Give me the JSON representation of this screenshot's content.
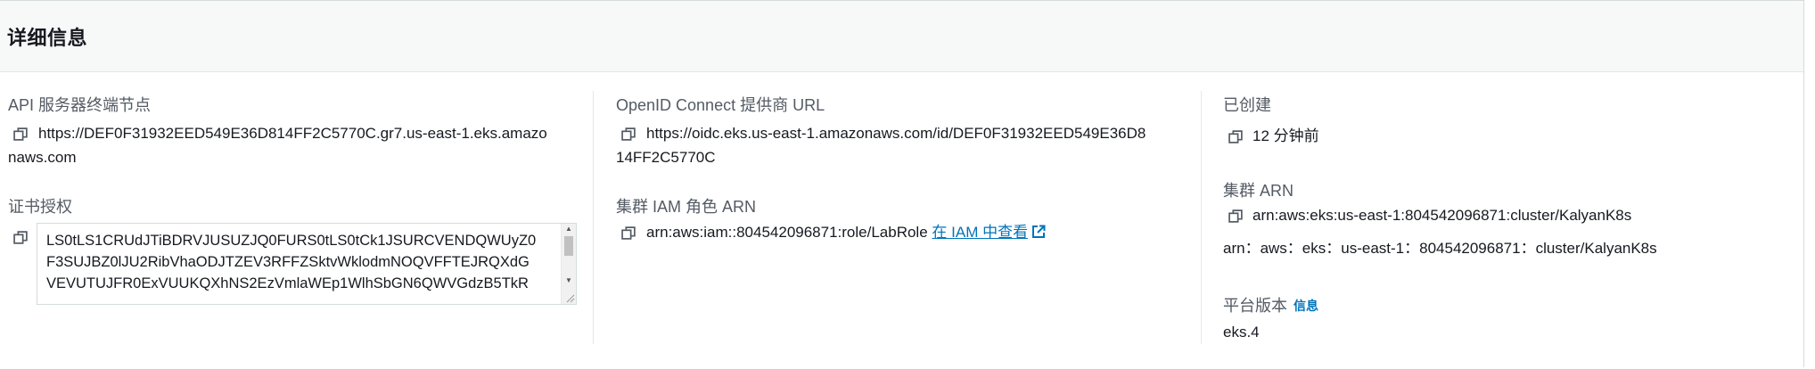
{
  "panel": {
    "title": "详细信息"
  },
  "api_endpoint": {
    "label": "API 服务器终端节点",
    "value_line1": "https://DEF0F31932EED549E36D814FF2C5770C.gr7.us-east-1.eks.amazo",
    "value_line2": "naws.com"
  },
  "certificate": {
    "label": "证书授权",
    "lines": [
      "LS0tLS1CRUdJTiBDRVJUSUZJQ0FURS0tLS0tCk1JSURCVENDQWUyZ0",
      "F3SUJBZ0lJU2RibVhaODJTZEV3RFFZSktvWklodmNOQVFFTEJRQXdG",
      "VEVUTUJFR0ExVUUKQXhNS2EzVmlaWEp1WlhSbGN6QWVGdzB5TkR"
    ]
  },
  "oidc": {
    "label": "OpenID Connect 提供商 URL",
    "value_line1": "https://oidc.eks.us-east-1.amazonaws.com/id/DEF0F31932EED549E36D8",
    "value_line2": "14FF2C5770C"
  },
  "cluster_iam_role": {
    "label": "集群 IAM 角色 ARN",
    "value": "arn:aws:iam::804542096871:role/LabRole",
    "link_text": "在 IAM 中查看"
  },
  "created": {
    "label": "已创建",
    "value": "12 分钟前"
  },
  "cluster_arn": {
    "label": "集群 ARN",
    "value": "arn:aws:eks:us-east-1:804542096871:cluster/KalyanK8s",
    "value_alt": "arn：aws：eks：us-east-1：804542096871：cluster/KalyanK8s"
  },
  "platform_version": {
    "label": "平台版本",
    "info_link": "信息",
    "value": "eks.4"
  },
  "colors": {
    "link": "#0073bb",
    "label": "#545b64",
    "text": "#16191f",
    "header_bg": "#f7f8f8"
  },
  "icons": {
    "copy": "copy-icon",
    "external": "external-link-icon"
  }
}
